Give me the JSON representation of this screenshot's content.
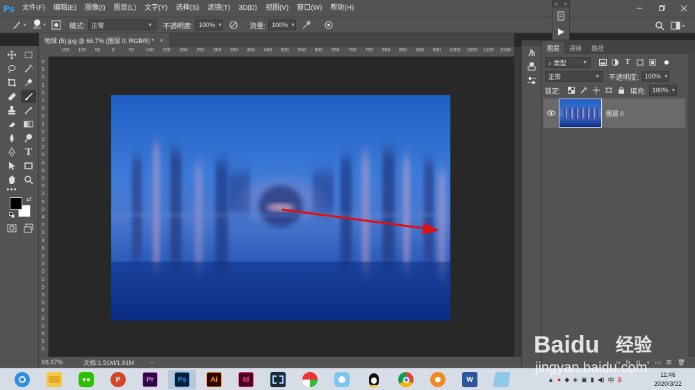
{
  "app": {
    "logo_text": "Ps",
    "menu": [
      "文件(F)",
      "编辑(E)",
      "图像(I)",
      "图层(L)",
      "文字(Y)",
      "选择(S)",
      "滤镜(T)",
      "3D(D)",
      "视图(V)",
      "窗口(W)",
      "帮助(H)"
    ]
  },
  "options_bar": {
    "brush_size": "301",
    "mode_label": "模式:",
    "mode_value": "正常",
    "opacity_label": "不透明度:",
    "opacity_value": "100%",
    "flow_label": "流量:",
    "flow_value": "100%"
  },
  "document": {
    "tab_title": "地球 (5).jpg @ 66.7% (图层 0, RGB/8) *",
    "tab_close": "×",
    "zoom": "66.67%",
    "doc_info": "文档:1.91M/1.91M",
    "ruler_h": [
      "150",
      "100",
      "50",
      "0",
      "50",
      "100",
      "150",
      "200",
      "250",
      "300",
      "350",
      "400",
      "450",
      "500",
      "550",
      "600",
      "650",
      "700",
      "750",
      "800",
      "850",
      "900",
      "950",
      "1000",
      "1050",
      "1100",
      "1150"
    ],
    "ruler_v": [
      "0",
      "5",
      "0",
      "1",
      "0",
      "1",
      "5",
      "0",
      "2",
      "0",
      "0",
      "2",
      "5",
      "0",
      "3",
      "0",
      "0",
      "3",
      "5",
      "0",
      "4",
      "0",
      "0",
      "4",
      "5",
      "0",
      "5",
      "0",
      "0",
      "5",
      "5",
      "0",
      "6",
      "0",
      "0",
      "6",
      "5",
      "0"
    ]
  },
  "layers_panel": {
    "tabs": [
      "图层",
      "通道",
      "路径"
    ],
    "filter_type": "类型",
    "blend_mode": "正常",
    "opacity_label": "不透明度:",
    "opacity_value": "100%",
    "lock_label": "锁定:",
    "fill_label": "填充:",
    "fill_value": "100%",
    "layer_name": "图层 0"
  },
  "taskbar": {
    "apps": [
      "Chrome-like browser",
      "File Explorer",
      "WeChat",
      "PowerPoint",
      "Premiere",
      "Photoshop",
      "Illustrator",
      "InDesign",
      "Video Editor",
      "Pinwheel",
      "Bird App",
      "QQ",
      "Chrome",
      "Orange App",
      "Word",
      "Tablet App"
    ],
    "app_letters": [
      "",
      "",
      "",
      "P",
      "Pr",
      "Ps",
      "Ai",
      "Id",
      "",
      "",
      "",
      "",
      "",
      "",
      "W",
      ""
    ],
    "clock_time": "11:46",
    "clock_date": "2020/3/22"
  },
  "watermark": {
    "brand": "Baidu",
    "brand_cn": "经验",
    "url": "jingyan.baidu.com"
  },
  "colors": {
    "ps_blue": "#31a8ff",
    "panel_bg": "#535353",
    "canvas_bg": "#282828",
    "arrow_red": "#e01010"
  }
}
